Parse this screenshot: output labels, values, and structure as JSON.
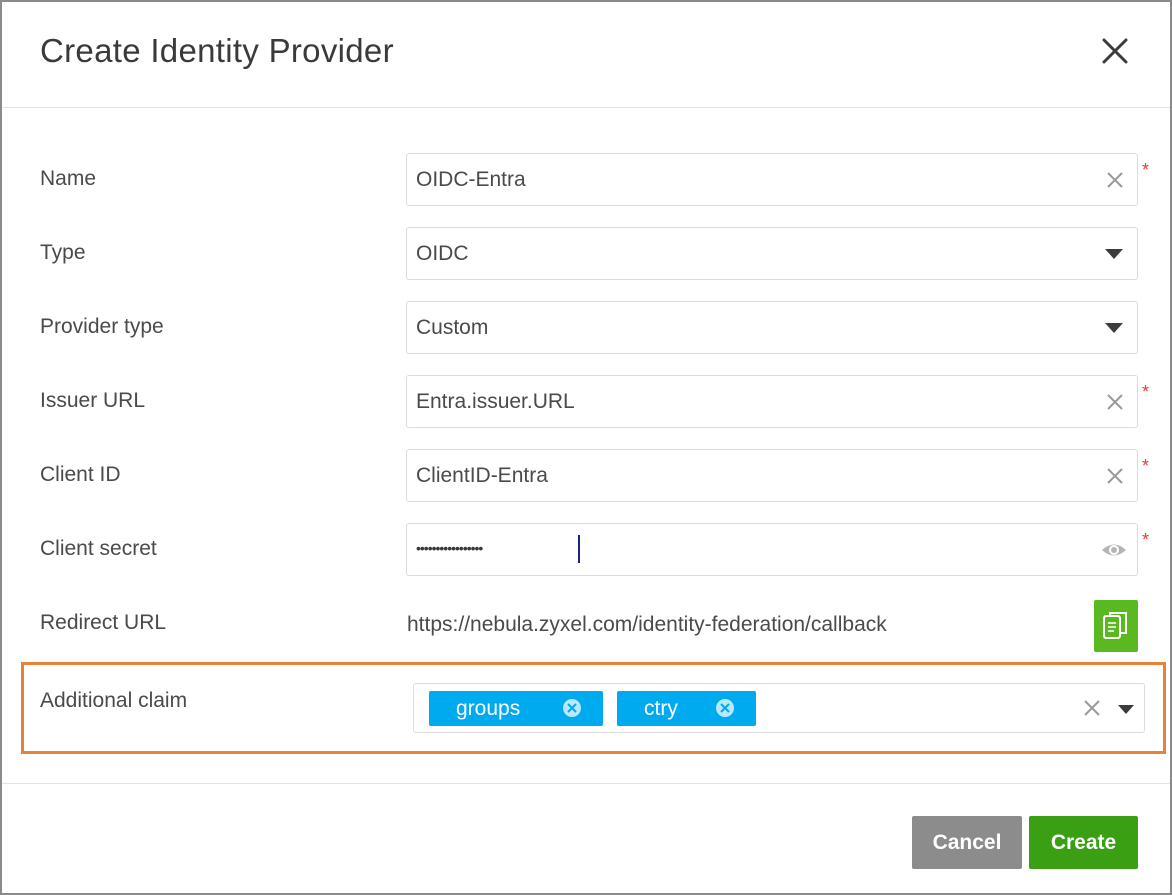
{
  "dialog": {
    "title": "Create Identity Provider"
  },
  "form": {
    "name": {
      "label": "Name",
      "value": "OIDC-Entra",
      "required": "*"
    },
    "type": {
      "label": "Type",
      "value": "OIDC"
    },
    "provider_type": {
      "label": "Provider type",
      "value": "Custom"
    },
    "issuer_url": {
      "label": "Issuer URL",
      "value": "Entra.issuer.URL",
      "required": "*"
    },
    "client_id": {
      "label": "Client ID",
      "value": "ClientID-Entra",
      "required": "*"
    },
    "client_secret": {
      "label": "Client secret",
      "value": "•••••••••••••••••",
      "required": "*"
    },
    "redirect_url": {
      "label": "Redirect URL",
      "value": "https://nebula.zyxel.com/identity-federation/callback"
    },
    "additional_claim": {
      "label": "Additional claim",
      "tags": [
        "groups",
        "ctry"
      ]
    }
  },
  "footer": {
    "cancel_label": "Cancel",
    "create_label": "Create"
  },
  "colors": {
    "accent_green": "#3a9f13",
    "copy_green": "#5ab820",
    "tag_blue": "#00aaee",
    "highlight_orange": "#e8823a",
    "required_red": "#e53935"
  }
}
